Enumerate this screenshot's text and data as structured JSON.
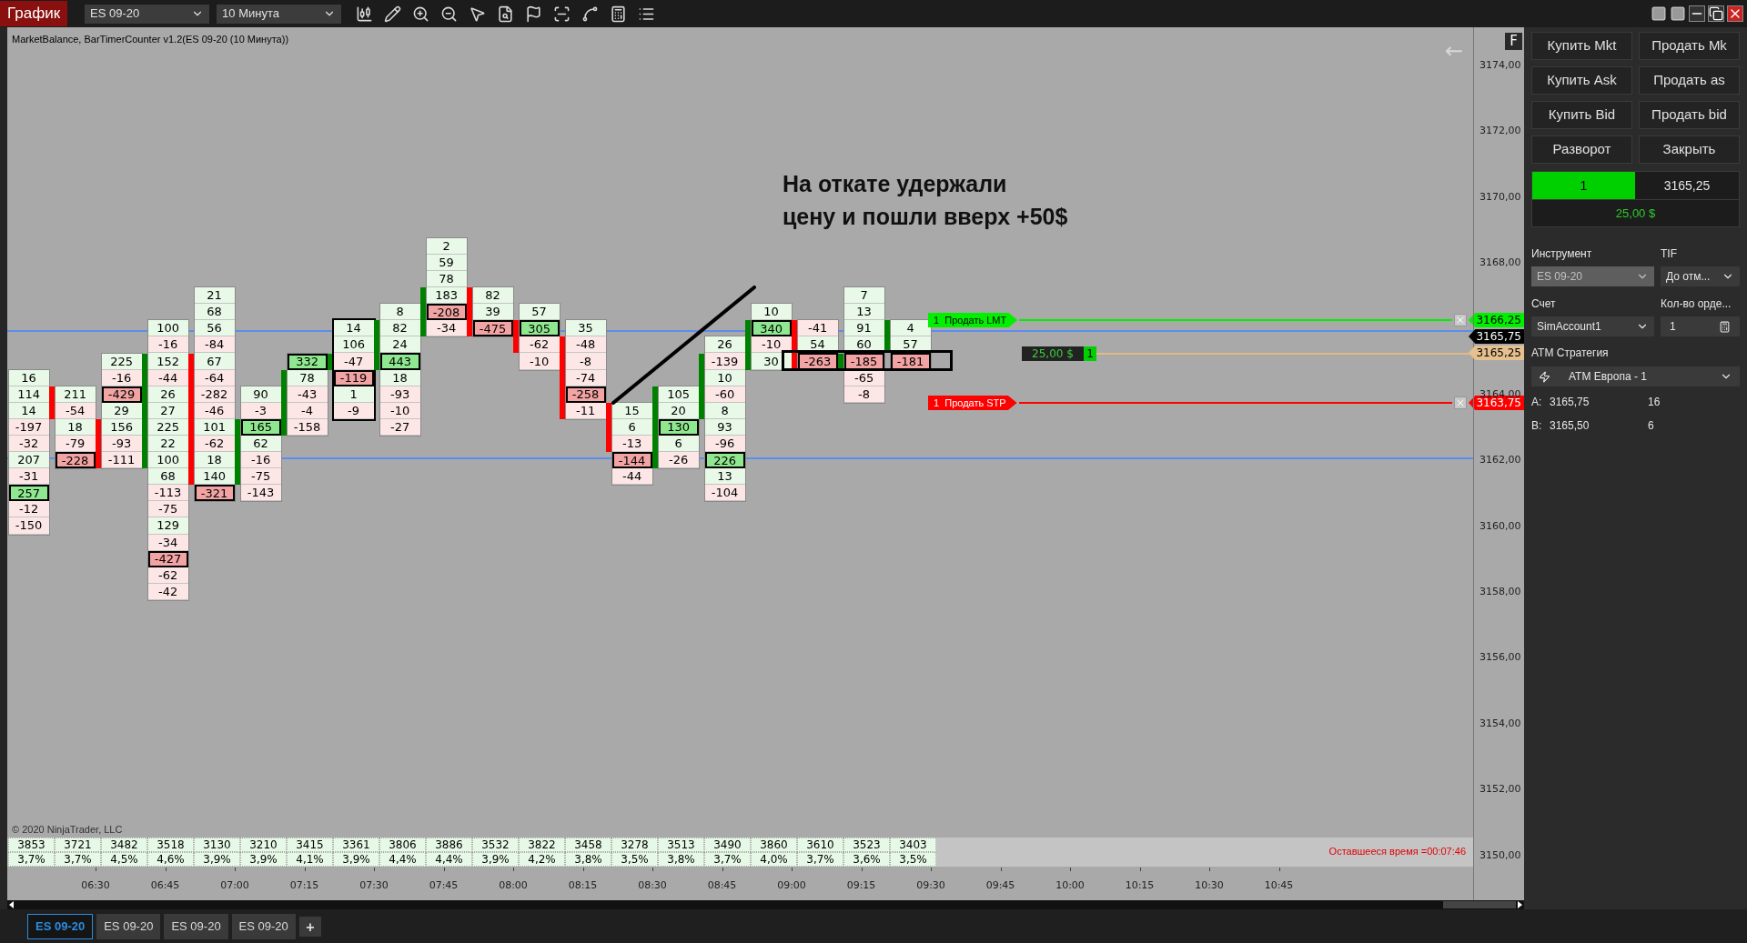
{
  "toolbar": {
    "chart_button": "График",
    "instrument": "ES 09-20",
    "interval": "10 Минута"
  },
  "chart": {
    "title": "MarketBalance, BarTimerCounter v1.2(ES 09-20 (10 Минута))",
    "axis_button": "F",
    "back_arrow": "←",
    "annotation": [
      "На откате удержали",
      "цену и пошли вверх +50$"
    ],
    "price_labels": [
      "3174,00",
      "3172,00",
      "3170,00",
      "3168,00",
      "3164,00",
      "3162,00",
      "3160,00",
      "3158,00",
      "3156,00",
      "3154,00",
      "3152,00",
      "3150,00"
    ],
    "last_price": "3165,75",
    "orders": [
      {
        "kind": "limit",
        "label": "1  Продать LMT",
        "price": "3166,25"
      },
      {
        "kind": "stop",
        "label": "1  Продать STP",
        "price": "3163,75"
      }
    ],
    "position": {
      "pnl": "25,00 $",
      "qty": "1",
      "price": "3165,25"
    },
    "columns": [
      {
        "outlined": false,
        "cells": [
          {
            "value": "16",
            "buy": true,
            "boxed": false
          },
          {
            "value": "114",
            "buy": true,
            "boxed": false
          },
          {
            "value": "14",
            "buy": true,
            "boxed": false
          },
          {
            "value": "-197",
            "buy": false,
            "boxed": false
          },
          {
            "value": "-32",
            "buy": false,
            "boxed": false
          },
          {
            "value": "207",
            "buy": true,
            "boxed": false
          },
          {
            "value": "-31",
            "buy": false,
            "boxed": false
          },
          {
            "value": "257",
            "buy": true,
            "boxed": true
          },
          {
            "value": "-12",
            "buy": false,
            "boxed": false
          },
          {
            "value": "-150",
            "buy": false,
            "boxed": false
          }
        ]
      },
      {
        "bar_up": false,
        "outlined": false,
        "cells": [
          {
            "value": "211",
            "buy": true,
            "boxed": false
          },
          {
            "value": "-54",
            "buy": false,
            "boxed": false
          },
          {
            "value": "18",
            "buy": true,
            "boxed": false
          },
          {
            "value": "-79",
            "buy": false,
            "boxed": false
          },
          {
            "value": "-228",
            "buy": false,
            "boxed": true
          }
        ]
      },
      {
        "bar_up": false,
        "outlined": false,
        "cells": [
          {
            "value": "225",
            "buy": true,
            "boxed": false
          },
          {
            "value": "-16",
            "buy": false,
            "boxed": false
          },
          {
            "value": "-429",
            "buy": false,
            "boxed": true
          },
          {
            "value": "29",
            "buy": true,
            "boxed": false
          },
          {
            "value": "156",
            "buy": true,
            "boxed": false
          },
          {
            "value": "-93",
            "buy": false,
            "boxed": false
          },
          {
            "value": "-111",
            "buy": false,
            "boxed": false
          }
        ]
      },
      {
        "bar_up": true,
        "outlined": false,
        "cells": [
          {
            "value": "100",
            "buy": true,
            "boxed": false
          },
          {
            "value": "-16",
            "buy": false,
            "boxed": false
          },
          {
            "value": "152",
            "buy": true,
            "boxed": false
          },
          {
            "value": "-44",
            "buy": false,
            "boxed": false
          },
          {
            "value": "26",
            "buy": true,
            "boxed": false
          },
          {
            "value": "27",
            "buy": true,
            "boxed": false
          },
          {
            "value": "225",
            "buy": true,
            "boxed": false
          },
          {
            "value": "22",
            "buy": true,
            "boxed": false
          },
          {
            "value": "100",
            "buy": true,
            "boxed": false
          },
          {
            "value": "68",
            "buy": true,
            "boxed": false
          },
          {
            "value": "-113",
            "buy": false,
            "boxed": false
          },
          {
            "value": "-75",
            "buy": false,
            "boxed": false
          },
          {
            "value": "129",
            "buy": true,
            "boxed": false
          },
          {
            "value": "-34",
            "buy": false,
            "boxed": false
          },
          {
            "value": "-427",
            "buy": false,
            "boxed": true
          },
          {
            "value": "-62",
            "buy": false,
            "boxed": false
          },
          {
            "value": "-42",
            "buy": false,
            "boxed": false
          }
        ]
      },
      {
        "bar_up": false,
        "outlined": false,
        "cells": [
          {
            "value": "21",
            "buy": true,
            "boxed": false
          },
          {
            "value": "68",
            "buy": true,
            "boxed": false
          },
          {
            "value": "56",
            "buy": true,
            "boxed": false
          },
          {
            "value": "-84",
            "buy": false,
            "boxed": false
          },
          {
            "value": "67",
            "buy": true,
            "boxed": false
          },
          {
            "value": "-64",
            "buy": false,
            "boxed": false
          },
          {
            "value": "-282",
            "buy": false,
            "boxed": false
          },
          {
            "value": "-46",
            "buy": false,
            "boxed": false
          },
          {
            "value": "101",
            "buy": true,
            "boxed": false
          },
          {
            "value": "-62",
            "buy": false,
            "boxed": false
          },
          {
            "value": "18",
            "buy": true,
            "boxed": false
          },
          {
            "value": "140",
            "buy": true,
            "boxed": false
          },
          {
            "value": "-321",
            "buy": false,
            "boxed": true
          }
        ]
      },
      {
        "bar_up": true,
        "outlined": false,
        "cells": [
          {
            "value": "90",
            "buy": true,
            "boxed": false
          },
          {
            "value": "-3",
            "buy": false,
            "boxed": false
          },
          {
            "value": "165",
            "buy": true,
            "boxed": true
          },
          {
            "value": "62",
            "buy": true,
            "boxed": false
          },
          {
            "value": "-16",
            "buy": false,
            "boxed": false
          },
          {
            "value": "-75",
            "buy": false,
            "boxed": false
          },
          {
            "value": "-143",
            "buy": false,
            "boxed": false
          }
        ]
      },
      {
        "bar_up": true,
        "outlined": false,
        "cells": [
          {
            "value": "332",
            "buy": true,
            "boxed": true
          },
          {
            "value": "78",
            "buy": true,
            "boxed": false
          },
          {
            "value": "-43",
            "buy": false,
            "boxed": false
          },
          {
            "value": "-4",
            "buy": false,
            "boxed": false
          },
          {
            "value": "-158",
            "buy": false,
            "boxed": false
          }
        ]
      },
      {
        "bar_up": true,
        "outlined": true,
        "cells": [
          {
            "value": "14",
            "buy": true,
            "boxed": false
          },
          {
            "value": "106",
            "buy": true,
            "boxed": false
          },
          {
            "value": "-47",
            "buy": false,
            "boxed": false
          },
          {
            "value": "-119",
            "buy": false,
            "boxed": true
          },
          {
            "value": "1",
            "buy": true,
            "boxed": false
          },
          {
            "value": "-9",
            "buy": false,
            "boxed": false
          }
        ]
      },
      {
        "bar_up": true,
        "outlined": false,
        "cells": [
          {
            "value": "8",
            "buy": true,
            "boxed": false
          },
          {
            "value": "82",
            "buy": true,
            "boxed": false
          },
          {
            "value": "24",
            "buy": true,
            "boxed": false
          },
          {
            "value": "443",
            "buy": true,
            "boxed": true
          },
          {
            "value": "18",
            "buy": true,
            "boxed": false
          },
          {
            "value": "-93",
            "buy": false,
            "boxed": false
          },
          {
            "value": "-10",
            "buy": false,
            "boxed": false
          },
          {
            "value": "-27",
            "buy": false,
            "boxed": false
          }
        ]
      },
      {
        "bar_up": true,
        "outlined": false,
        "cells": [
          {
            "value": "2",
            "buy": true,
            "boxed": false
          },
          {
            "value": "59",
            "buy": true,
            "boxed": false
          },
          {
            "value": "78",
            "buy": true,
            "boxed": false
          },
          {
            "value": "183",
            "buy": true,
            "boxed": false
          },
          {
            "value": "-208",
            "buy": false,
            "boxed": true
          },
          {
            "value": "-34",
            "buy": false,
            "boxed": false
          }
        ]
      },
      {
        "bar_up": false,
        "outlined": false,
        "cells": [
          {
            "value": "82",
            "buy": true,
            "boxed": false
          },
          {
            "value": "39",
            "buy": true,
            "boxed": false
          },
          {
            "value": "-475",
            "buy": false,
            "boxed": true
          }
        ]
      },
      {
        "bar_up": false,
        "outlined": false,
        "cells": [
          {
            "value": "57",
            "buy": true,
            "boxed": false
          },
          {
            "value": "305",
            "buy": true,
            "boxed": true
          },
          {
            "value": "-62",
            "buy": false,
            "boxed": false
          },
          {
            "value": "-10",
            "buy": false,
            "boxed": false
          }
        ]
      },
      {
        "bar_up": false,
        "outlined": false,
        "cells": [
          {
            "value": "35",
            "buy": true,
            "boxed": false
          },
          {
            "value": "-48",
            "buy": false,
            "boxed": false
          },
          {
            "value": "-8",
            "buy": false,
            "boxed": false
          },
          {
            "value": "-74",
            "buy": false,
            "boxed": false
          },
          {
            "value": "-258",
            "buy": false,
            "boxed": true
          },
          {
            "value": "-11",
            "buy": false,
            "boxed": false
          }
        ]
      },
      {
        "bar_up": false,
        "outlined": false,
        "cells": [
          {
            "value": "15",
            "buy": true,
            "boxed": false
          },
          {
            "value": "6",
            "buy": true,
            "boxed": false
          },
          {
            "value": "-13",
            "buy": false,
            "boxed": false
          },
          {
            "value": "-144",
            "buy": false,
            "boxed": true
          },
          {
            "value": "-44",
            "buy": false,
            "boxed": false
          }
        ]
      },
      {
        "bar_up": true,
        "outlined": false,
        "cells": [
          {
            "value": "105",
            "buy": true,
            "boxed": false
          },
          {
            "value": "20",
            "buy": true,
            "boxed": false
          },
          {
            "value": "130",
            "buy": true,
            "boxed": true
          },
          {
            "value": "6",
            "buy": true,
            "boxed": false
          },
          {
            "value": "-26",
            "buy": false,
            "boxed": false
          }
        ]
      },
      {
        "bar_up": true,
        "outlined": false,
        "cells": [
          {
            "value": "26",
            "buy": true,
            "boxed": false
          },
          {
            "value": "-139",
            "buy": false,
            "boxed": false
          },
          {
            "value": "10",
            "buy": true,
            "boxed": false
          },
          {
            "value": "-60",
            "buy": false,
            "boxed": false
          },
          {
            "value": "8",
            "buy": true,
            "boxed": false
          },
          {
            "value": "93",
            "buy": true,
            "boxed": false
          },
          {
            "value": "-96",
            "buy": false,
            "boxed": false
          },
          {
            "value": "226",
            "buy": true,
            "boxed": true
          },
          {
            "value": "13",
            "buy": true,
            "boxed": false
          },
          {
            "value": "-104",
            "buy": false,
            "boxed": false
          }
        ]
      },
      {
        "bar_up": true,
        "outlined": false,
        "cells": [
          {
            "value": "10",
            "buy": true,
            "boxed": false
          },
          {
            "value": "340",
            "buy": true,
            "boxed": true
          },
          {
            "value": "-10",
            "buy": false,
            "boxed": false
          },
          {
            "value": "30",
            "buy": true,
            "boxed": false
          }
        ]
      },
      {
        "bar_up": false,
        "outlined": false,
        "cells": [
          {
            "value": "-41",
            "buy": false,
            "boxed": false
          },
          {
            "value": "54",
            "buy": true,
            "boxed": false
          },
          {
            "value": "-263",
            "buy": false,
            "boxed": true
          }
        ]
      },
      {
        "bar_up": true,
        "outlined": false,
        "cells": [
          {
            "value": "7",
            "buy": true,
            "boxed": false
          },
          {
            "value": "13",
            "buy": true,
            "boxed": false
          },
          {
            "value": "91",
            "buy": true,
            "boxed": false
          },
          {
            "value": "60",
            "buy": true,
            "boxed": false
          },
          {
            "value": "-185",
            "buy": false,
            "boxed": true
          },
          {
            "value": "-65",
            "buy": false,
            "boxed": false
          },
          {
            "value": "-8",
            "buy": false,
            "boxed": false
          }
        ]
      },
      {
        "bar_up": true,
        "outlined": false,
        "cells": [
          {
            "value": "4",
            "buy": true,
            "boxed": false
          },
          {
            "value": "57",
            "buy": true,
            "boxed": false
          },
          {
            "value": "-181",
            "buy": false,
            "boxed": true
          }
        ]
      }
    ],
    "stats": [
      {
        "volume": "3853",
        "percent": "3,7%"
      },
      {
        "volume": "3721",
        "percent": "3,7%"
      },
      {
        "volume": "3482",
        "percent": "4,5%"
      },
      {
        "volume": "3518",
        "percent": "4,6%"
      },
      {
        "volume": "3130",
        "percent": "3,9%"
      },
      {
        "volume": "3210",
        "percent": "3,9%"
      },
      {
        "volume": "3415",
        "percent": "4,1%"
      },
      {
        "volume": "3361",
        "percent": "3,9%"
      },
      {
        "volume": "3806",
        "percent": "4,4%"
      },
      {
        "volume": "3886",
        "percent": "4,4%"
      },
      {
        "volume": "3532",
        "percent": "3,9%"
      },
      {
        "volume": "3822",
        "percent": "4,2%"
      },
      {
        "volume": "3458",
        "percent": "3,8%"
      },
      {
        "volume": "3278",
        "percent": "3,5%"
      },
      {
        "volume": "3513",
        "percent": "3,8%"
      },
      {
        "volume": "3490",
        "percent": "3,7%"
      },
      {
        "volume": "3860",
        "percent": "4,0%"
      },
      {
        "volume": "3610",
        "percent": "3,7%"
      },
      {
        "volume": "3523",
        "percent": "3,6%"
      },
      {
        "volume": "3403",
        "percent": "3,5%"
      }
    ],
    "copyright": "© 2020 NinjaTrader, LLC",
    "remaining_time": "Оставшееся время =00:07:46",
    "time_labels": [
      "06:30",
      "06:45",
      "07:00",
      "07:15",
      "07:30",
      "07:45",
      "08:00",
      "08:15",
      "08:30",
      "08:45",
      "09:00",
      "09:15",
      "09:30",
      "09:45",
      "10:00",
      "10:15",
      "10:30",
      "10:45"
    ]
  },
  "order_panel": {
    "buttons": [
      "Купить Mkt",
      "Продать Mk",
      "Купить Ask",
      "Продать as",
      "Купить Bid",
      "Продать bid",
      "Разворот",
      "Закрыть"
    ],
    "position": {
      "qty": "1",
      "price": "3165,25",
      "pnl": "25,00 $"
    },
    "instrument": {
      "label": "Инструмент",
      "value": "ES 09-20",
      "disabled": true
    },
    "tif": {
      "label": "TIF",
      "value": "До отм..."
    },
    "account": {
      "label": "Счет",
      "value": "SimAccount1"
    },
    "quantity": {
      "label": "Кол-во орде...",
      "value": "1"
    },
    "atm": {
      "label": "АТМ Стратегия",
      "value": "АТМ Европа - 1"
    },
    "quotes": [
      {
        "label": "A:",
        "price": "3165,75",
        "size": "16"
      },
      {
        "label": "B:",
        "price": "3165,50",
        "size": "6"
      }
    ]
  },
  "tabs": [
    {
      "label": "ES 09-20",
      "selected": true
    },
    {
      "label": "ES 09-20",
      "selected": false
    },
    {
      "label": "ES 09-20",
      "selected": false
    },
    {
      "label": "ES 09-20",
      "selected": false
    }
  ],
  "add_tab": "+"
}
